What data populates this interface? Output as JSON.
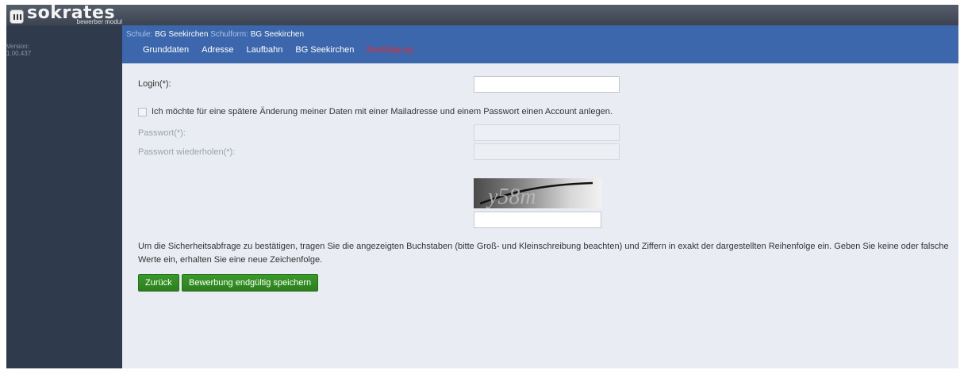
{
  "app": {
    "logo_text": "sokrates",
    "logo_subtitle": "bewerber modul",
    "version_label": "Version:",
    "version_number": "1.00.437"
  },
  "header": {
    "schule_label": "Schule:",
    "schule_value": "BG Seekirchen",
    "schulform_label": "Schulform:",
    "schulform_value": "BG Seekirchen",
    "tabs": [
      {
        "label": "Grunddaten"
      },
      {
        "label": "Adresse"
      },
      {
        "label": "Laufbahn"
      },
      {
        "label": "BG Seekirchen"
      },
      {
        "label": "Bestätigung"
      }
    ],
    "active_tab": "Bestätigung",
    "active_color": "#d9313b"
  },
  "form": {
    "login_label": "Login(*):",
    "login_value": "",
    "account_checkbox_label": "Ich möchte für eine spätere Änderung meiner Daten mit einer Mailadresse und einem Passwort einen Account anlegen.",
    "account_checked": false,
    "password_label": "Passwort(*):",
    "password_repeat_label": "Passwort wiederholen(*):",
    "captcha_image_text": "y58m",
    "captcha_value": "",
    "notice_text": "Um die Sicherheitsabfrage zu bestätigen, tragen Sie die angezeigten Buchstaben (bitte Groß- und Kleinschreibung beachten) und Ziffern in exakt der dargestellten Reihenfolge ein. Geben Sie keine oder falsche Werte ein, erhalten Sie eine neue Zeichenfolge."
  },
  "buttons": {
    "back_label": "Zurück",
    "save_label": "Bewerbung endgültig speichern"
  },
  "colors": {
    "topbar": "#3c4452",
    "sidebar": "#2f3a4c",
    "header": "#3c67ac",
    "content_bg": "#e9edf3",
    "button_green": "#2b7f1d"
  }
}
